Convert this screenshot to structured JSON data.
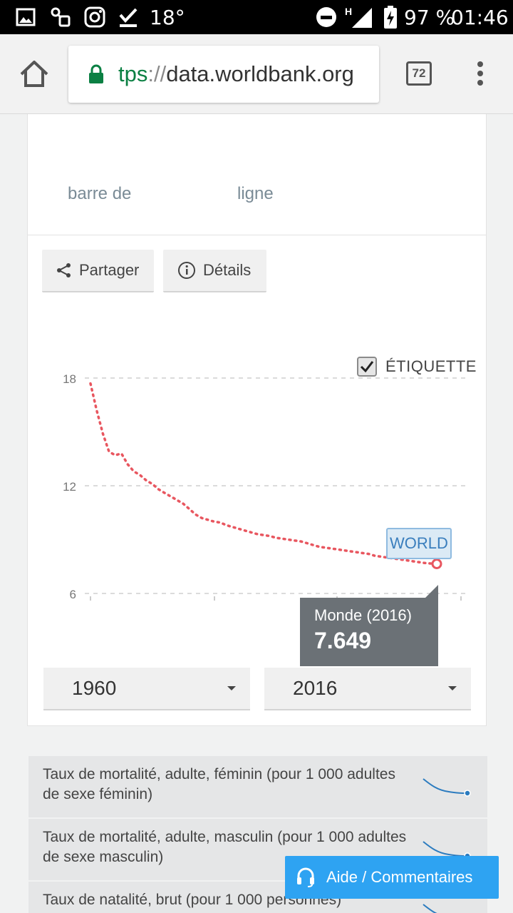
{
  "status_bar": {
    "temperature": "18°",
    "network_type": "H",
    "battery": "97 %",
    "time": "01:46"
  },
  "browser": {
    "url_scheme": "tps",
    "url_sep": "://",
    "url_host": "data.worldbank.org",
    "tab_count": "72"
  },
  "chart_tabs": {
    "bar": "barre de",
    "line": "ligne"
  },
  "actions": {
    "share": "Partager",
    "details": "Détails"
  },
  "chart_label_toggle": "ÉTIQUETTE",
  "world_label": "WORLD",
  "tooltip": {
    "title": "Monde (2016)",
    "value": "7.649"
  },
  "year_range": {
    "start": "1960",
    "end": "2016"
  },
  "related": [
    {
      "label": "Taux de mortalité, adulte, féminin (pour 1 000 adultes de sexe féminin)"
    },
    {
      "label": "Taux de mortalité, adulte, masculin (pour 1 000 adultes de sexe masculin)"
    },
    {
      "label": "Taux de natalité, brut (pour 1 000 personnes)"
    }
  ],
  "help_button": "Aide / Commentaires",
  "colors": {
    "series": "#e8565f",
    "help": "#2ea3f2",
    "url_scheme": "#0b8043"
  },
  "chart_data": {
    "type": "line",
    "series": [
      {
        "name": "WORLD",
        "x": [
          1960,
          1961,
          1962,
          1963,
          1964,
          1965,
          1966,
          1967,
          1968,
          1969,
          1970,
          1971,
          1972,
          1973,
          1974,
          1975,
          1976,
          1977,
          1978,
          1979,
          1980,
          1981,
          1982,
          1983,
          1984,
          1985,
          1986,
          1987,
          1988,
          1989,
          1990,
          1991,
          1992,
          1993,
          1994,
          1995,
          1996,
          1997,
          1998,
          1999,
          2000,
          2001,
          2002,
          2003,
          2004,
          2005,
          2006,
          2007,
          2008,
          2009,
          2010,
          2011,
          2012,
          2013,
          2014,
          2015,
          2016
        ],
        "values": [
          17.7,
          16.2,
          14.9,
          13.9,
          13.7,
          13.8,
          13.2,
          12.8,
          12.6,
          12.3,
          12.1,
          11.8,
          11.6,
          11.4,
          11.2,
          11.0,
          10.7,
          10.4,
          10.2,
          10.1,
          10.0,
          9.95,
          9.8,
          9.7,
          9.6,
          9.5,
          9.4,
          9.3,
          9.25,
          9.2,
          9.1,
          9.05,
          9.0,
          8.95,
          8.9,
          8.8,
          8.7,
          8.6,
          8.55,
          8.5,
          8.45,
          8.4,
          8.35,
          8.3,
          8.25,
          8.2,
          8.1,
          8.05,
          8.0,
          7.95,
          7.9,
          7.85,
          7.8,
          7.75,
          7.7,
          7.67,
          7.649
        ]
      }
    ],
    "y_ticks": [
      6,
      12,
      18
    ],
    "ylim": [
      6,
      18.5
    ],
    "xlim": [
      1960,
      2016
    ],
    "grid": true,
    "title": "",
    "xlabel": "",
    "ylabel": ""
  }
}
